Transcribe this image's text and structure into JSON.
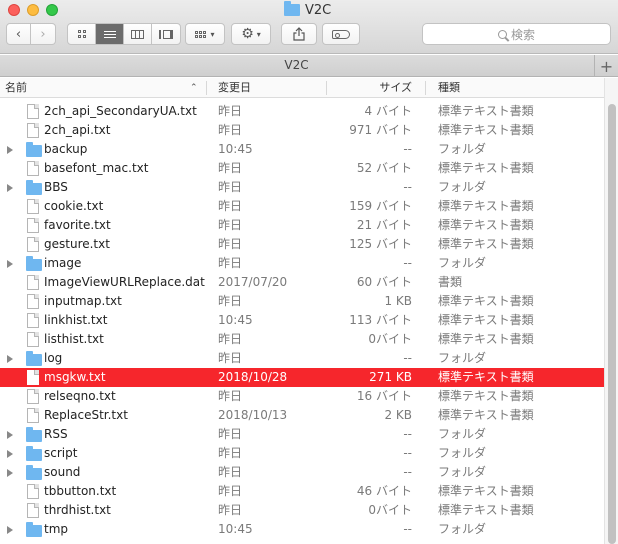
{
  "window": {
    "title": "V2C"
  },
  "toolbar": {
    "back_icon": "chevron-left-icon",
    "forward_icon": "chevron-right-icon",
    "search_placeholder": "検索"
  },
  "pathbar": {
    "title": "V2C",
    "add_tab_label": "+"
  },
  "columns": {
    "name": "名前",
    "date": "変更日",
    "size": "サイズ",
    "kind": "種類"
  },
  "files": [
    {
      "name": "2ch_api_SecondaryUA.txt",
      "date": "昨日",
      "size": "4 バイト",
      "kind": "標準テキスト書類",
      "type": "file"
    },
    {
      "name": "2ch_api.txt",
      "date": "昨日",
      "size": "971 バイト",
      "kind": "標準テキスト書類",
      "type": "file"
    },
    {
      "name": "backup",
      "date": "10:45",
      "size": "--",
      "kind": "フォルダ",
      "type": "folder"
    },
    {
      "name": "basefont_mac.txt",
      "date": "昨日",
      "size": "52 バイト",
      "kind": "標準テキスト書類",
      "type": "file"
    },
    {
      "name": "BBS",
      "date": "昨日",
      "size": "--",
      "kind": "フォルダ",
      "type": "folder"
    },
    {
      "name": "cookie.txt",
      "date": "昨日",
      "size": "159 バイト",
      "kind": "標準テキスト書類",
      "type": "file"
    },
    {
      "name": "favorite.txt",
      "date": "昨日",
      "size": "21 バイト",
      "kind": "標準テキスト書類",
      "type": "file"
    },
    {
      "name": "gesture.txt",
      "date": "昨日",
      "size": "125 バイト",
      "kind": "標準テキスト書類",
      "type": "file"
    },
    {
      "name": "image",
      "date": "昨日",
      "size": "--",
      "kind": "フォルダ",
      "type": "folder"
    },
    {
      "name": "ImageViewURLReplace.dat",
      "date": "2017/07/20",
      "size": "60 バイト",
      "kind": "書類",
      "type": "file"
    },
    {
      "name": "inputmap.txt",
      "date": "昨日",
      "size": "1 KB",
      "kind": "標準テキスト書類",
      "type": "file"
    },
    {
      "name": "linkhist.txt",
      "date": "10:45",
      "size": "113 バイト",
      "kind": "標準テキスト書類",
      "type": "file"
    },
    {
      "name": "listhist.txt",
      "date": "昨日",
      "size": "0バイト",
      "kind": "標準テキスト書類",
      "type": "file"
    },
    {
      "name": "log",
      "date": "昨日",
      "size": "--",
      "kind": "フォルダ",
      "type": "folder"
    },
    {
      "name": "msgkw.txt",
      "date": "2018/10/28",
      "size": "271 KB",
      "kind": "標準テキスト書類",
      "type": "file",
      "selected": true
    },
    {
      "name": "relseqno.txt",
      "date": "昨日",
      "size": "16 バイト",
      "kind": "標準テキスト書類",
      "type": "file"
    },
    {
      "name": "ReplaceStr.txt",
      "date": "2018/10/13",
      "size": "2 KB",
      "kind": "標準テキスト書類",
      "type": "file"
    },
    {
      "name": "RSS",
      "date": "昨日",
      "size": "--",
      "kind": "フォルダ",
      "type": "folder"
    },
    {
      "name": "script",
      "date": "昨日",
      "size": "--",
      "kind": "フォルダ",
      "type": "folder"
    },
    {
      "name": "sound",
      "date": "昨日",
      "size": "--",
      "kind": "フォルダ",
      "type": "folder"
    },
    {
      "name": "tbbutton.txt",
      "date": "昨日",
      "size": "46 バイト",
      "kind": "標準テキスト書類",
      "type": "file"
    },
    {
      "name": "thrdhist.txt",
      "date": "昨日",
      "size": "0バイト",
      "kind": "標準テキスト書類",
      "type": "file"
    },
    {
      "name": "tmp",
      "date": "10:45",
      "size": "--",
      "kind": "フォルダ",
      "type": "folder"
    }
  ],
  "colors": {
    "selection": "#f6262c",
    "folder": "#6fb7f0"
  }
}
